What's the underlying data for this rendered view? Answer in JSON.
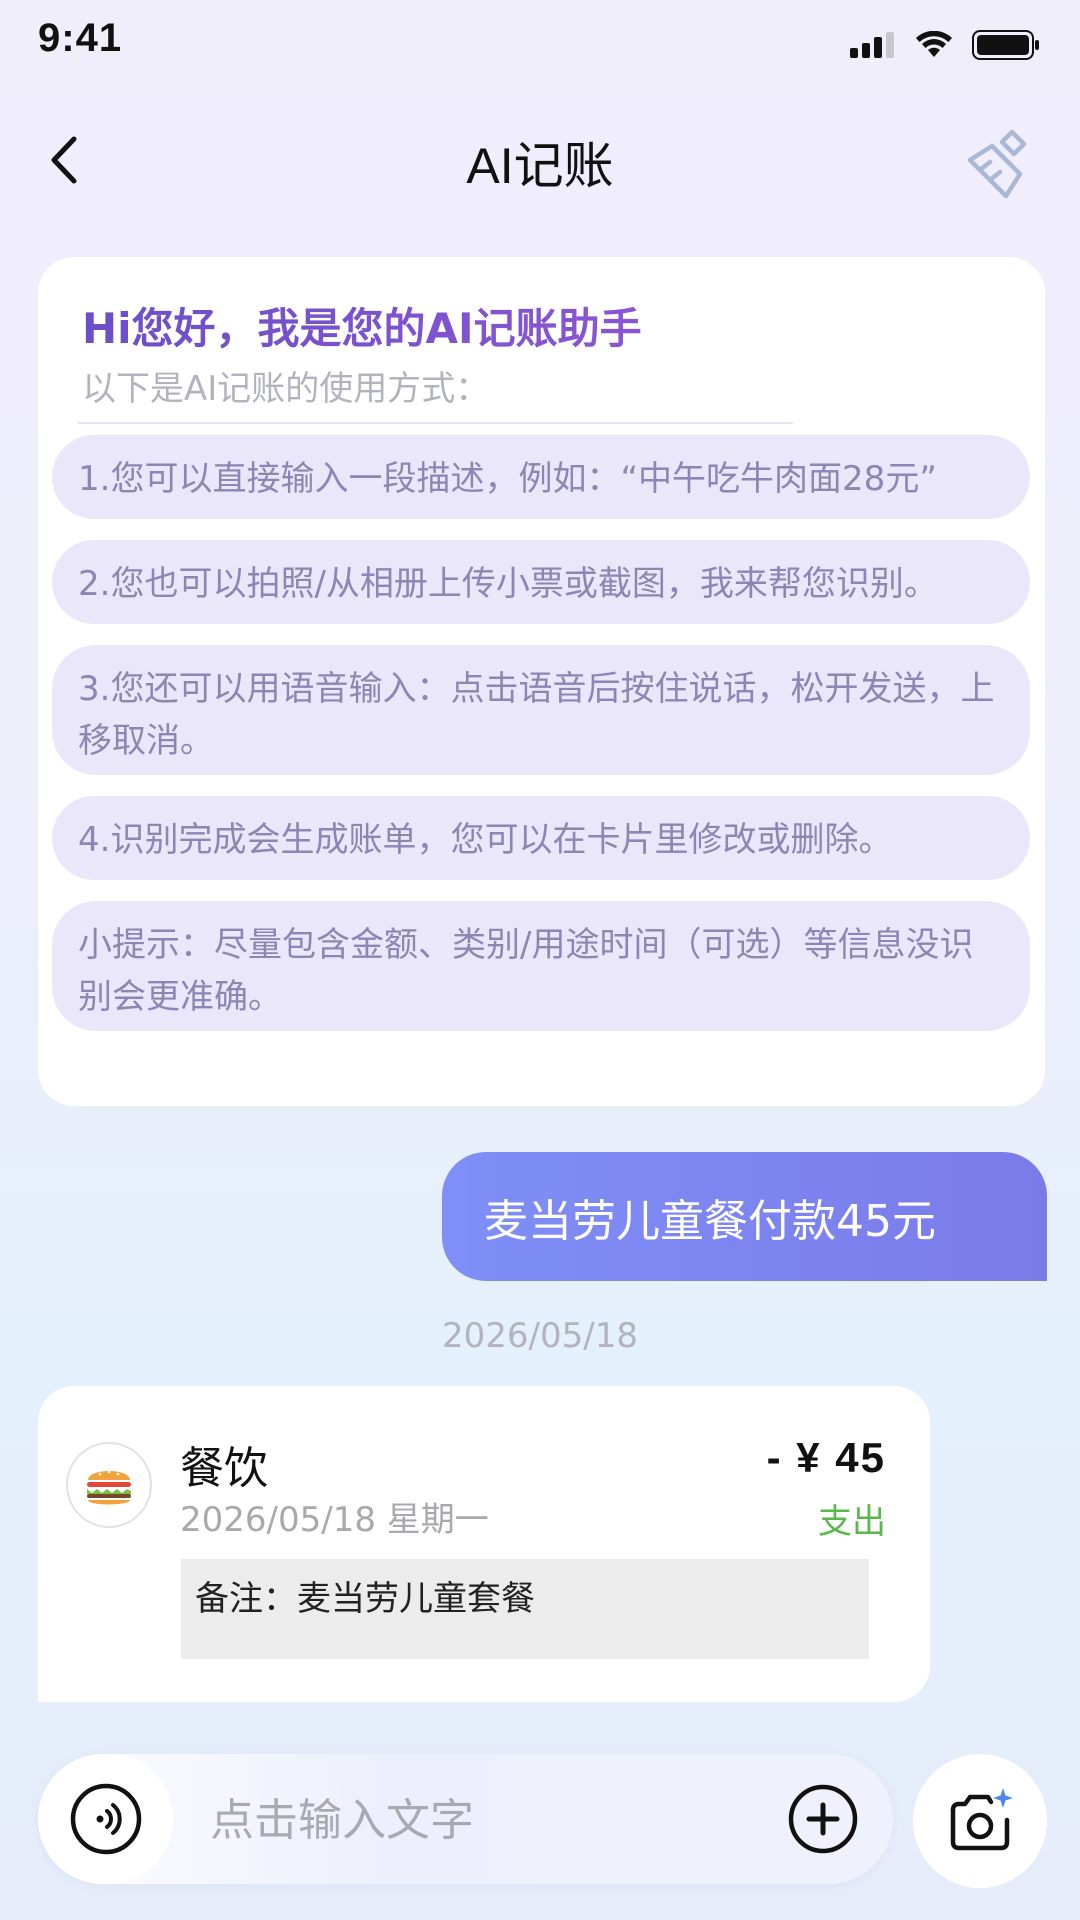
{
  "status_bar": {
    "time": "9:41"
  },
  "nav": {
    "title": "AI记账",
    "back_icon": "chevron-left-icon",
    "clear_icon": "broom-icon"
  },
  "intro": {
    "title": "Hi您好，我是您的AI记账助手",
    "subtitle": "以下是AI记账的使用方式：",
    "tips": [
      "1.您可以直接输入一段描述，例如：“中午吃牛肉面28元”",
      "2.您也可以拍照/从相册上传小票或截图，我来帮您识别。",
      "3.您还可以用语音输入：点击语音后按住说话，松开发送，上移取消。",
      "4.识别完成会生成账单，您可以在卡片里修改或删除。",
      "小提示：尽量包含金额、类别/用途时间（可选）等信息没识别会更准确。"
    ]
  },
  "user_message": "麦当劳儿童餐付款45元",
  "date_separator": "2026/05/18",
  "bill": {
    "icon": "burger-icon",
    "category": "餐饮",
    "date": "2026/05/18 星期一",
    "amount": "- ¥ 45",
    "type": "支出",
    "note": "备注：麦当劳儿童套餐"
  },
  "input": {
    "placeholder": "点击输入文字",
    "voice_icon": "voice-icon",
    "add_icon": "plus-circle-icon",
    "camera_icon": "camera-icon"
  },
  "colors": {
    "accent_purple": "#7156cf",
    "tip_background": "#eae7fb",
    "tip_text": "#8c86b4",
    "user_bubble": "#7a84f0",
    "expense_green": "#58b84a"
  }
}
